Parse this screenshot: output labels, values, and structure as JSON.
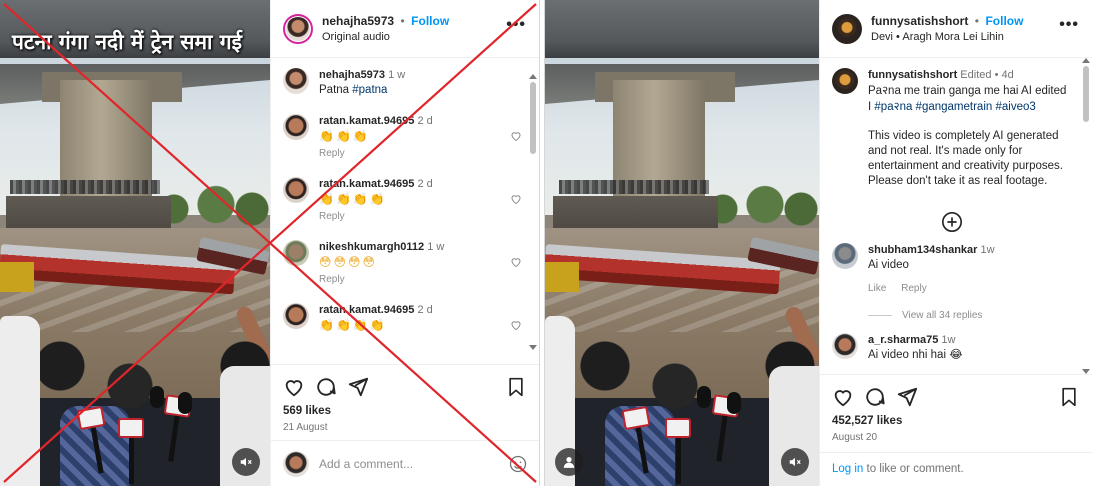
{
  "left": {
    "video": {
      "overlay_title": "पटना गंगा नदी में ट्रेन समा गई",
      "mute_icon": "speaker-mute-icon"
    },
    "header": {
      "username": "nehajha5973",
      "separator": "•",
      "follow_label": "Follow",
      "subtitle": "Original audio"
    },
    "caption": {
      "username": "nehajha5973",
      "time": "1 w",
      "text": "Patna",
      "hashtag": "#patna"
    },
    "comments": [
      {
        "username": "ratan.kamat.94695",
        "time": "2 d",
        "emojis": "👏👏👏",
        "reply": "Reply"
      },
      {
        "username": "ratan.kamat.94695",
        "time": "2 d",
        "emojis": "👏👏👏👏",
        "reply": "Reply"
      },
      {
        "username": "nikeshkumargh0112",
        "time": "1 w",
        "emojis": "😳😳😳😳",
        "reply": "Reply"
      },
      {
        "username": "ratan.kamat.94695",
        "time": "2 d",
        "emojis": "👏👏👏👏",
        "reply": ""
      }
    ],
    "likes": "569 likes",
    "date": "21 August",
    "add_comment_placeholder": "Add a comment...",
    "overlay_color": "#e0262b"
  },
  "right": {
    "header": {
      "username": "funnysatishshort",
      "separator": "•",
      "follow_label": "Follow",
      "subtitle": "Devi • Aragh Mora Lei Lihin"
    },
    "caption": {
      "username": "funnysatishshort",
      "edited": "Edited",
      "separator": "•",
      "time": "4d",
      "line1": "Pa२na me train ganga me hai AI edited",
      "line2_prefix": "I",
      "hashtags": "#pa२na #gangametrain #aiveo3",
      "disclaimer": "This video is completely AI generated and not real. It's made only for entertainment and creativity purposes. Please don't take it as real footage."
    },
    "comments": [
      {
        "username": "shubham134shankar",
        "time": "1w",
        "text": "Ai video",
        "like": "Like",
        "reply": "Reply"
      },
      {
        "username": "a_r.sharma75",
        "time": "1w",
        "text": "Ai video nhi hai 😂"
      }
    ],
    "view_replies": "View all 34 replies",
    "likes": "452,527 likes",
    "date": "August 20",
    "login_link": "Log in",
    "login_rest": " to like or comment."
  },
  "colors": {
    "accent": "#0095f6",
    "text": "#262626",
    "muted": "#737373",
    "cross": "#e0262b"
  }
}
